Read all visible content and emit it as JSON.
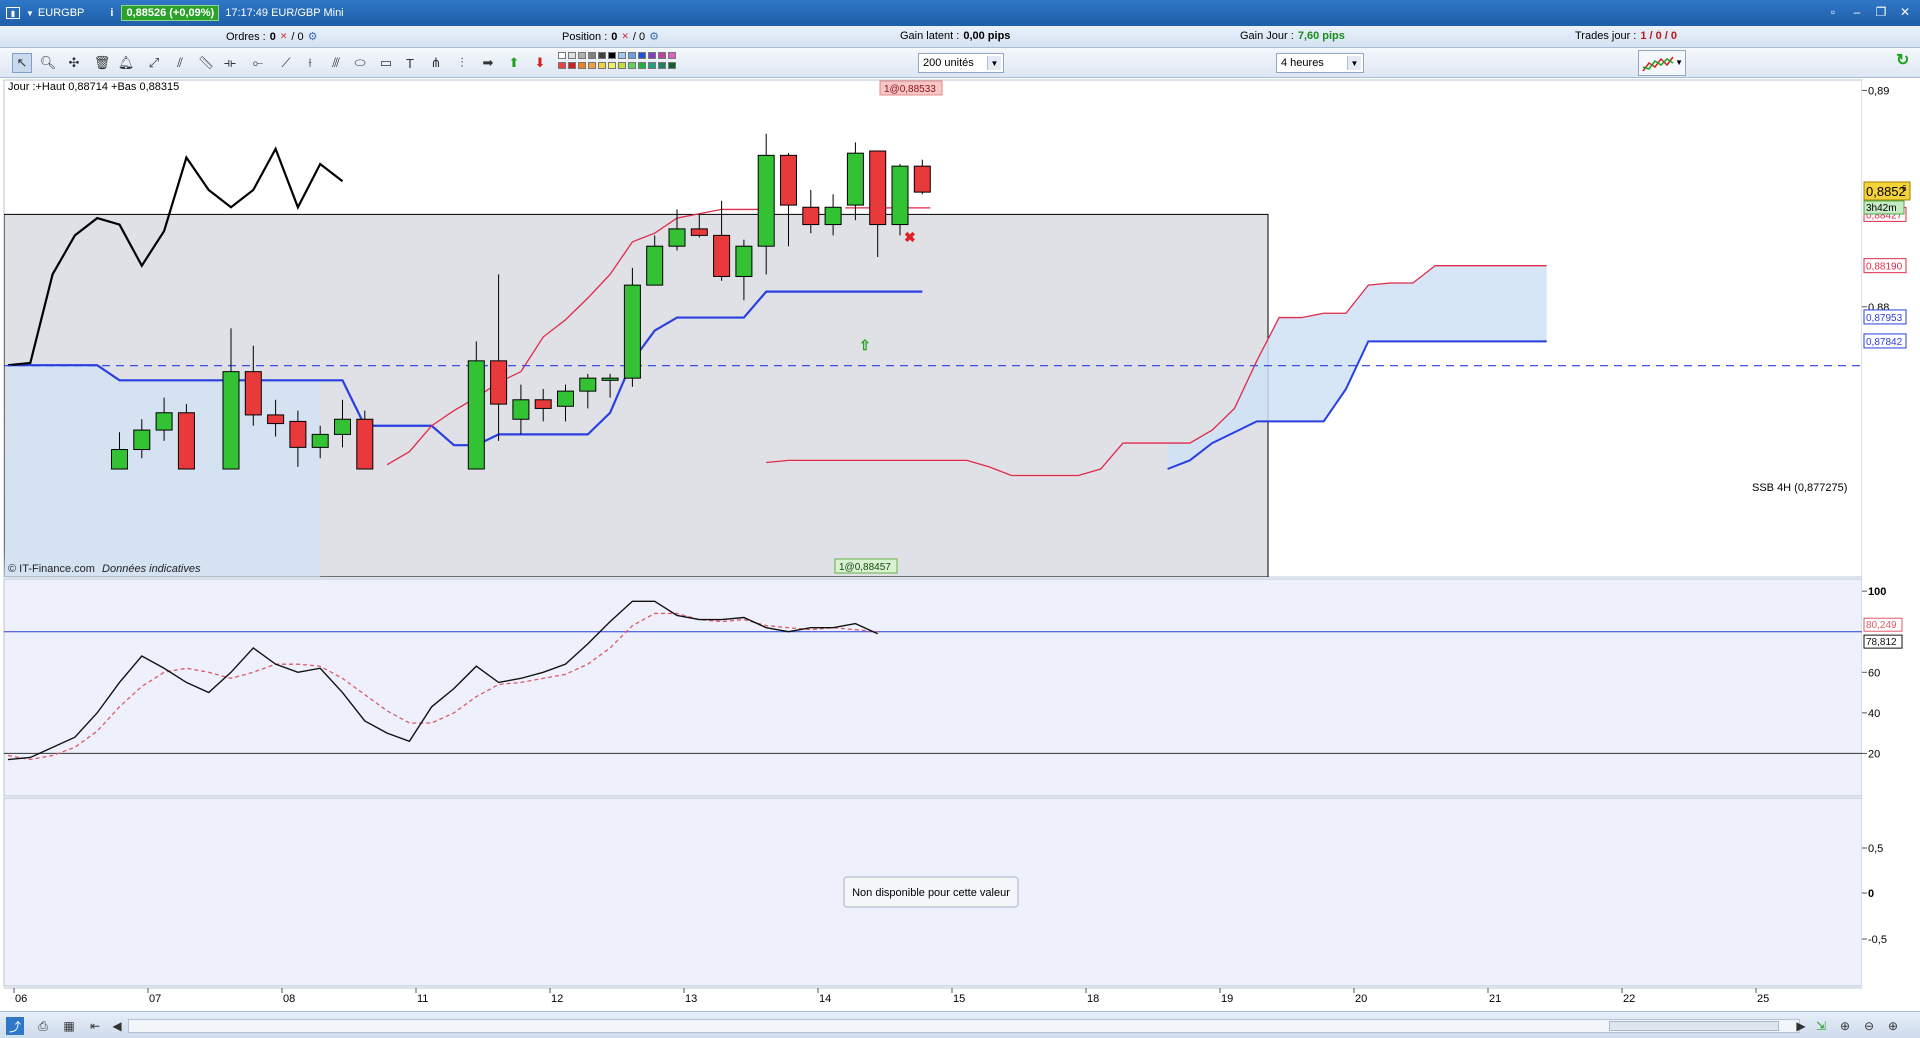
{
  "window": {
    "instrument": "EURGBP",
    "price_badge": "0,88526 (+0,09%)",
    "time_label": "17:17:49 EUR/GBP Mini"
  },
  "info": {
    "orders_label": "Ordres :",
    "orders_value": "0",
    "orders_total": "/ 0",
    "position_label": "Position :",
    "position_value": "0",
    "position_total": "/ 0",
    "gain_latent_label": "Gain latent :",
    "gain_latent_value": "0,00 pips",
    "gain_jour_label": "Gain Jour :",
    "gain_jour_value": "7,60 pips",
    "trades_label": "Trades jour :",
    "trades_value": "1 / 0 / 0"
  },
  "toolbar": {
    "quantity_select": "200 unités",
    "timeframe_select": "4 heures"
  },
  "chart_data": [
    {
      "type": "candlestick",
      "header_text": "Jour :+Haut 0,88714 +Bas 0,88315",
      "watermark": "© IT-Finance.com",
      "watermark_note": "Données indicatives",
      "ylim": [
        0.8725,
        0.8915
      ],
      "y_ticks": [
        "0,89",
        "0,88"
      ],
      "x_ticks": [
        "06",
        "07",
        "08",
        "11",
        "12",
        "13",
        "14",
        "15",
        "18",
        "19",
        "20",
        "21",
        "22",
        "25"
      ],
      "current_price_label": "0,8852",
      "current_price_sub": "6",
      "countdown_label": "3h42m",
      "price_labels": [
        "0,88427",
        "0,88190",
        "0,87953",
        "0,87842"
      ],
      "ssb_label": "SSB 4H (0,877275)",
      "ssb_value": 0.877275,
      "order_label_top": "1@0,88533",
      "order_label_bottom": "1@0,88457",
      "daily_box": {
        "high": 0.88427,
        "low": 0.8725
      },
      "candles": [
        {
          "i": 5,
          "o": 0.8725,
          "h": 0.8742,
          "l": 0.8725,
          "c": 0.8734
        },
        {
          "i": 6,
          "o": 0.8734,
          "h": 0.8748,
          "l": 0.873,
          "c": 0.8743
        },
        {
          "i": 7,
          "o": 0.8743,
          "h": 0.8758,
          "l": 0.8738,
          "c": 0.8751
        },
        {
          "i": 8,
          "o": 0.8751,
          "h": 0.8755,
          "l": 0.8725,
          "c": 0.8725
        },
        {
          "i": 10,
          "o": 0.8725,
          "h": 0.879,
          "l": 0.8725,
          "c": 0.877
        },
        {
          "i": 11,
          "o": 0.877,
          "h": 0.8782,
          "l": 0.8745,
          "c": 0.875
        },
        {
          "i": 12,
          "o": 0.875,
          "h": 0.8757,
          "l": 0.874,
          "c": 0.8746
        },
        {
          "i": 13,
          "o": 0.8747,
          "h": 0.8752,
          "l": 0.8726,
          "c": 0.8735
        },
        {
          "i": 14,
          "o": 0.8735,
          "h": 0.8745,
          "l": 0.873,
          "c": 0.8741
        },
        {
          "i": 15,
          "o": 0.8741,
          "h": 0.8757,
          "l": 0.8735,
          "c": 0.8748
        },
        {
          "i": 16,
          "o": 0.8748,
          "h": 0.8752,
          "l": 0.8725,
          "c": 0.8725
        },
        {
          "i": 21,
          "o": 0.8725,
          "h": 0.8784,
          "l": 0.8725,
          "c": 0.8775
        },
        {
          "i": 22,
          "o": 0.8775,
          "h": 0.8815,
          "l": 0.8738,
          "c": 0.8755
        },
        {
          "i": 23,
          "o": 0.8748,
          "h": 0.8764,
          "l": 0.8741,
          "c": 0.8757
        },
        {
          "i": 24,
          "o": 0.8757,
          "h": 0.8762,
          "l": 0.8747,
          "c": 0.8753
        },
        {
          "i": 25,
          "o": 0.8754,
          "h": 0.8764,
          "l": 0.8747,
          "c": 0.8761
        },
        {
          "i": 26,
          "o": 0.8761,
          "h": 0.8769,
          "l": 0.8753,
          "c": 0.8767
        },
        {
          "i": 27,
          "o": 0.8766,
          "h": 0.8769,
          "l": 0.8758,
          "c": 0.8767
        },
        {
          "i": 28,
          "o": 0.8767,
          "h": 0.8818,
          "l": 0.8763,
          "c": 0.881
        },
        {
          "i": 29,
          "o": 0.881,
          "h": 0.8833,
          "l": 0.881,
          "c": 0.8828
        },
        {
          "i": 30,
          "o": 0.8828,
          "h": 0.8845,
          "l": 0.8826,
          "c": 0.8836
        },
        {
          "i": 31,
          "o": 0.8836,
          "h": 0.8843,
          "l": 0.8832,
          "c": 0.8833
        },
        {
          "i": 32,
          "o": 0.8833,
          "h": 0.8849,
          "l": 0.8812,
          "c": 0.8814
        },
        {
          "i": 33,
          "o": 0.8814,
          "h": 0.8831,
          "l": 0.8803,
          "c": 0.8828
        },
        {
          "i": 34,
          "o": 0.8828,
          "h": 0.888,
          "l": 0.8815,
          "c": 0.887
        },
        {
          "i": 35,
          "o": 0.887,
          "h": 0.8871,
          "l": 0.8828,
          "c": 0.8847
        },
        {
          "i": 36,
          "o": 0.8846,
          "h": 0.8854,
          "l": 0.8834,
          "c": 0.8838
        },
        {
          "i": 37,
          "o": 0.8838,
          "h": 0.8852,
          "l": 0.8833,
          "c": 0.8846
        },
        {
          "i": 38,
          "o": 0.8847,
          "h": 0.8876,
          "l": 0.884,
          "c": 0.8871
        },
        {
          "i": 39,
          "o": 0.8872,
          "h": 0.8872,
          "l": 0.8823,
          "c": 0.8838
        },
        {
          "i": 40,
          "o": 0.8838,
          "h": 0.8866,
          "l": 0.8833,
          "c": 0.8865
        },
        {
          "i": 41,
          "o": 0.8865,
          "h": 0.8868,
          "l": 0.8852,
          "c": 0.8853
        }
      ],
      "chikou_span": {
        "start_i": 0,
        "values": [
          0.8773,
          0.8774,
          0.8815,
          0.8833,
          0.8841,
          0.8838,
          0.8819,
          0.8835,
          0.8869,
          0.8854,
          0.8846,
          0.8854,
          0.8873,
          0.8846,
          0.8866,
          0.8858
        ]
      },
      "tenkan_sen": {
        "start_i": 17,
        "values": [
          0.8727,
          0.8733,
          0.8745,
          0.8752,
          0.8758,
          0.8765,
          0.877,
          0.8786,
          0.8794,
          0.8804,
          0.8815,
          0.883,
          0.8834,
          0.8841,
          0.8843,
          0.8845,
          0.8845,
          0.8845
        ]
      },
      "kijun_sen": {
        "start_i": 0,
        "values": [
          0.8773,
          0.8773,
          0.8773,
          0.8773,
          0.8773,
          0.8766,
          0.8766,
          0.8766,
          0.8766,
          0.8766,
          0.8766,
          0.8766,
          0.8766,
          0.8766,
          0.8766,
          0.8766,
          0.8745,
          0.8745,
          0.8745,
          0.8745,
          0.8736,
          0.8736,
          0.8741,
          0.8741,
          0.8741,
          0.8741,
          0.8741,
          0.8751,
          0.8775,
          0.8789,
          0.8795,
          0.8795,
          0.8795,
          0.8795,
          0.8807,
          0.8807,
          0.8807,
          0.8807,
          0.8807,
          0.8807,
          0.8807,
          0.8807
        ]
      },
      "senkou_a": {
        "start_i": 34,
        "values": [
          0.8728,
          0.8729,
          0.8729,
          0.8729,
          0.8729,
          0.8729,
          0.8729,
          0.8729,
          0.8729,
          0.8729,
          0.8726,
          0.8722,
          0.8722,
          0.8722,
          0.8722,
          0.8725,
          0.8737,
          0.8737,
          0.8737,
          0.8737,
          0.8743,
          0.8753,
          0.8775,
          0.8795,
          0.8795,
          0.8797,
          0.8797,
          0.881,
          0.8811,
          0.8811,
          0.8819,
          0.8819,
          0.8819,
          0.8819,
          0.8819,
          0.8819
        ]
      },
      "senkou_b": {
        "start_i": 52,
        "values": [
          0.8725,
          0.8729,
          0.8737,
          0.8742,
          0.8747,
          0.8747,
          0.8747,
          0.8747,
          0.8762,
          0.8784,
          0.8784,
          0.8784,
          0.8784,
          0.8784,
          0.8784,
          0.8784,
          0.8784,
          0.8784
        ]
      }
    },
    {
      "type": "line",
      "name": "oscillator",
      "ylim": [
        0,
        105
      ],
      "y_ticks": [
        "100",
        "60",
        "40",
        "20"
      ],
      "levels": [
        80,
        20
      ],
      "current_labels": [
        "80,249",
        "78,812"
      ],
      "series_main": {
        "start_i": 0,
        "values": [
          17,
          18,
          23,
          28,
          40,
          55,
          68,
          62,
          55,
          50,
          60,
          72,
          64,
          60,
          62,
          50,
          36,
          30,
          26,
          43,
          52,
          63,
          55,
          57,
          60,
          64,
          74,
          85,
          95,
          95,
          88,
          86,
          86,
          87,
          82,
          80,
          82,
          82,
          84,
          79
        ]
      },
      "series_signal": {
        "start_i": 0,
        "values": [
          19,
          17,
          19,
          23,
          31,
          43,
          53,
          60,
          62,
          60,
          57,
          60,
          64,
          64,
          63,
          57,
          49,
          41,
          35,
          35,
          40,
          48,
          54,
          55,
          57,
          59,
          64,
          72,
          83,
          89,
          89,
          86,
          85,
          86,
          83,
          82,
          81,
          82,
          81,
          80
        ]
      }
    }
  ],
  "lower_panel": {
    "message": "Non disponible pour cette valeur",
    "y_ticks": [
      "0,5",
      "0",
      "-0,5"
    ]
  },
  "colors": {
    "bull": "#33c233",
    "bear": "#e83a3a",
    "kijun": "#2a3fe0",
    "tenkan": "#e02a4a",
    "cloud": "#cfe2f6",
    "chikou": "#000000"
  }
}
